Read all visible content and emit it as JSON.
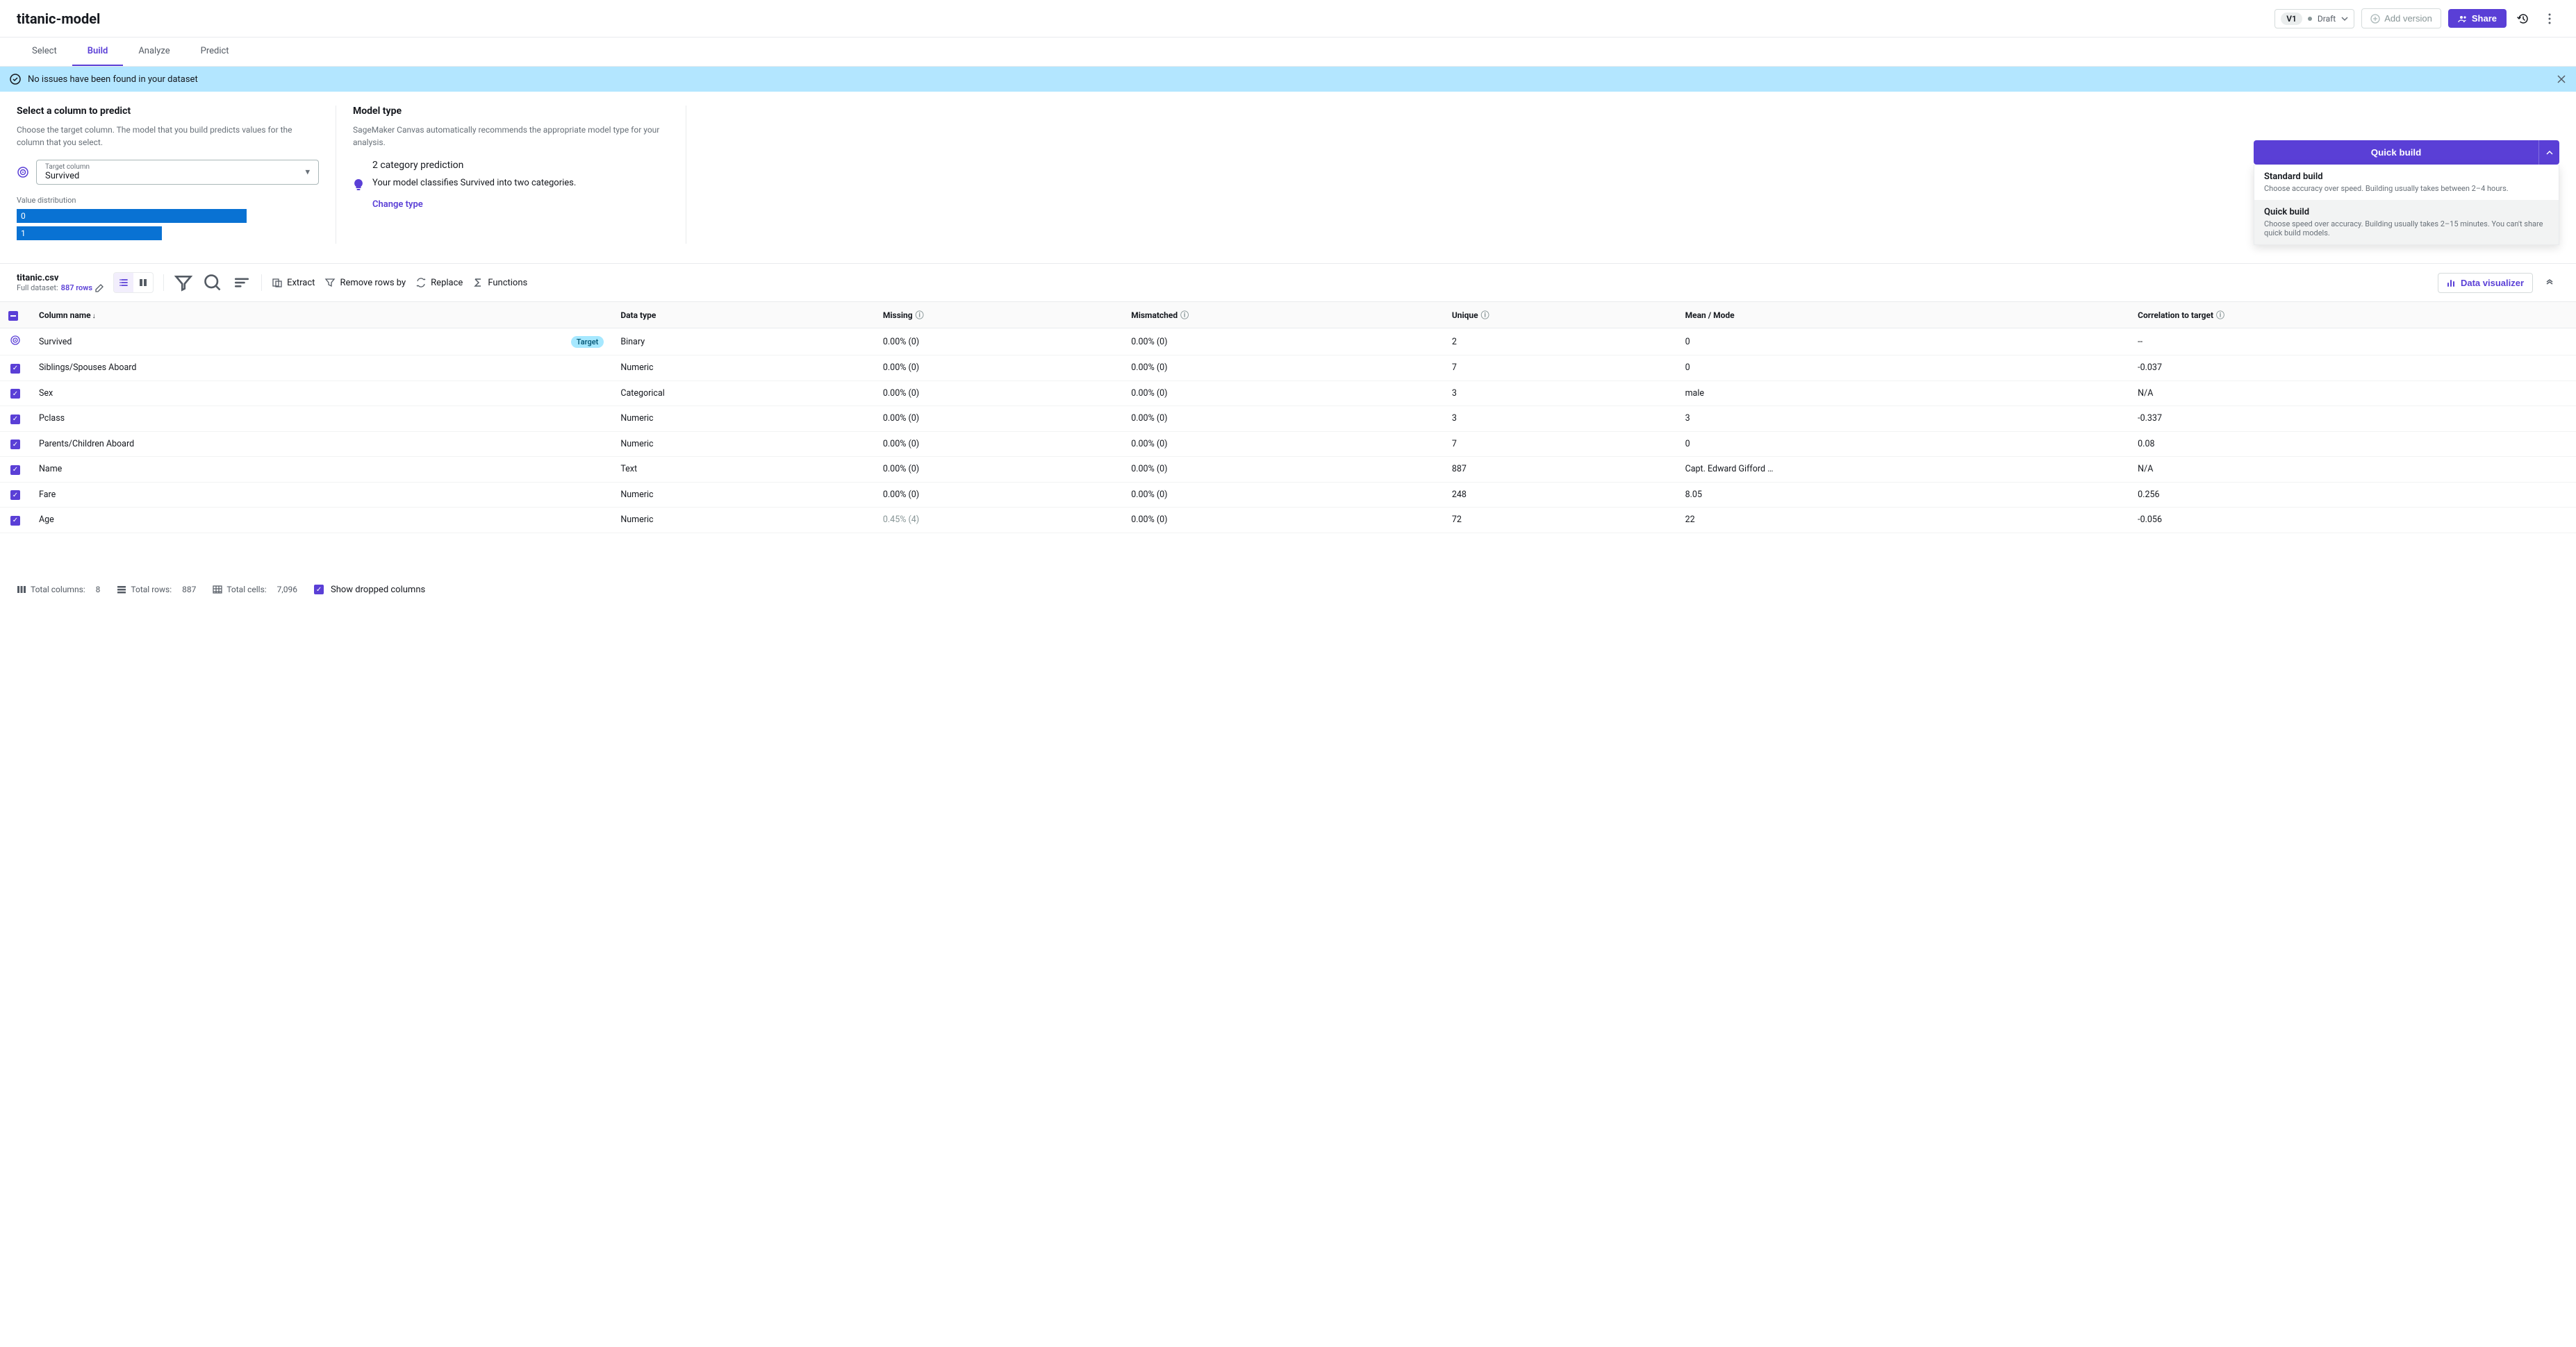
{
  "header": {
    "title": "titanic-model",
    "version": "V1",
    "status": "Draft",
    "add_version": "Add version",
    "share": "Share"
  },
  "tabs": [
    "Select",
    "Build",
    "Analyze",
    "Predict"
  ],
  "active_tab": "Build",
  "banner": {
    "text": "No issues have been found in your dataset"
  },
  "predict_panel": {
    "title": "Select a column to predict",
    "desc": "Choose the target column. The model that you build predicts values for the column that you select.",
    "target_label": "Target column",
    "target_value": "Survived",
    "value_dist_label": "Value distribution",
    "bars": [
      {
        "label": "0",
        "width": 76
      },
      {
        "label": "1",
        "width": 48
      }
    ]
  },
  "model_panel": {
    "title": "Model type",
    "desc": "SageMaker Canvas automatically recommends the appropriate model type for your analysis.",
    "prediction_title": "2 category prediction",
    "prediction_desc": "Your model classifies Survived into two categories.",
    "change_type": "Change type"
  },
  "build_button": {
    "label": "Quick build",
    "options": [
      {
        "title": "Standard build",
        "desc": "Choose accuracy over speed. Building usually takes between 2–4 hours.",
        "selected": false
      },
      {
        "title": "Quick build",
        "desc": "Choose speed over accuracy. Building usually takes 2–15 minutes. You can't share quick build models.",
        "selected": true
      }
    ]
  },
  "dataset": {
    "filename": "titanic.csv",
    "full_dataset_prefix": "Full dataset:",
    "rows_link": "887 rows",
    "toolbar": {
      "extract": "Extract",
      "remove": "Remove rows by",
      "replace": "Replace",
      "functions": "Functions",
      "data_viz": "Data visualizer"
    },
    "headers": {
      "column_name": "Column name",
      "data_type": "Data type",
      "missing": "Missing",
      "mismatched": "Mismatched",
      "unique": "Unique",
      "mean_mode": "Mean / Mode",
      "correlation": "Correlation to target"
    },
    "rows": [
      {
        "target": true,
        "name": "Survived",
        "type": "Binary",
        "missing": "0.00% (0)",
        "mismatched": "0.00% (0)",
        "unique": "2",
        "mean": "0",
        "corr": "--"
      },
      {
        "target": false,
        "name": "Siblings/Spouses Aboard",
        "type": "Numeric",
        "missing": "0.00% (0)",
        "mismatched": "0.00% (0)",
        "unique": "7",
        "mean": "0",
        "corr": "-0.037"
      },
      {
        "target": false,
        "name": "Sex",
        "type": "Categorical",
        "missing": "0.00% (0)",
        "mismatched": "0.00% (0)",
        "unique": "3",
        "mean": "male",
        "corr": "N/A"
      },
      {
        "target": false,
        "name": "Pclass",
        "type": "Numeric",
        "missing": "0.00% (0)",
        "mismatched": "0.00% (0)",
        "unique": "3",
        "mean": "3",
        "corr": "-0.337"
      },
      {
        "target": false,
        "name": "Parents/Children Aboard",
        "type": "Numeric",
        "missing": "0.00% (0)",
        "mismatched": "0.00% (0)",
        "unique": "7",
        "mean": "0",
        "corr": "0.08"
      },
      {
        "target": false,
        "name": "Name",
        "type": "Text",
        "missing": "0.00% (0)",
        "mismatched": "0.00% (0)",
        "unique": "887",
        "mean": "Capt. Edward Gifford …",
        "corr": "N/A"
      },
      {
        "target": false,
        "name": "Fare",
        "type": "Numeric",
        "missing": "0.00% (0)",
        "mismatched": "0.00% (0)",
        "unique": "248",
        "mean": "8.05",
        "corr": "0.256"
      },
      {
        "target": false,
        "name": "Age",
        "type": "Numeric",
        "missing": "0.45% (4)",
        "missing_muted": true,
        "mismatched": "0.00% (0)",
        "unique": "72",
        "mean": "22",
        "corr": "-0.056"
      }
    ]
  },
  "footer": {
    "total_columns_label": "Total columns:",
    "total_columns": "8",
    "total_rows_label": "Total rows:",
    "total_rows": "887",
    "total_cells_label": "Total cells:",
    "total_cells": "7,096",
    "show_dropped": "Show dropped columns"
  }
}
